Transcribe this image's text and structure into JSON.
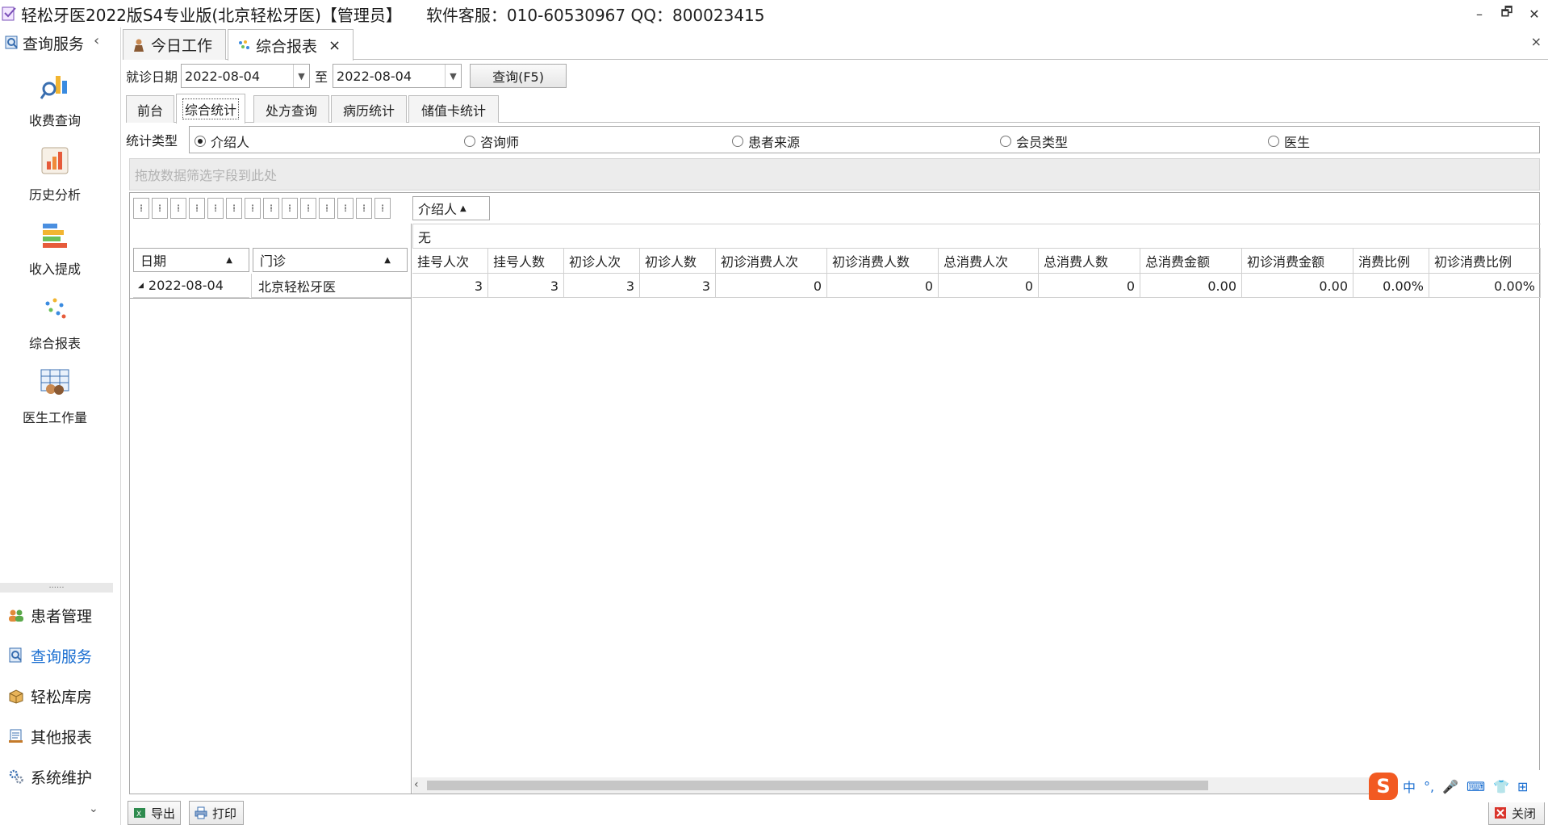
{
  "window": {
    "title": "轻松牙医2022版S4专业版(北京轻松牙医)【管理员】",
    "support": "软件客服：010-60530967 QQ：800023415",
    "controls": [
      "–",
      "🗗",
      "✕"
    ]
  },
  "sidebar": {
    "header": "查询服务",
    "collapse_glyph": "‹",
    "big_items": [
      {
        "label": "收费查询",
        "icon": "fee-query-icon"
      },
      {
        "label": "历史分析",
        "icon": "history-analysis-icon"
      },
      {
        "label": "收入提成",
        "icon": "income-commission-icon"
      },
      {
        "label": "综合报表",
        "icon": "comprehensive-report-icon"
      },
      {
        "label": "医生工作量",
        "icon": "doctor-workload-icon"
      }
    ],
    "grip": "......",
    "groups": [
      {
        "label": "患者管理",
        "icon": "patients-icon"
      },
      {
        "label": "查询服务",
        "icon": "query-service-icon",
        "active": true
      },
      {
        "label": "轻松库房",
        "icon": "warehouse-icon"
      },
      {
        "label": "其他报表",
        "icon": "other-reports-icon"
      },
      {
        "label": "系统维护",
        "icon": "system-maintenance-icon"
      }
    ],
    "more_glyph": "⌄"
  },
  "doc_tabs": [
    {
      "label": "今日工作",
      "icon": "today-work-icon"
    },
    {
      "label": "综合报表",
      "icon": "report-icon",
      "active": true,
      "close": "×"
    }
  ],
  "doc_close": "×",
  "filter": {
    "date_label": "就诊日期",
    "date_from": "2022-08-04",
    "to_label": "至",
    "date_to": "2022-08-04",
    "query_button": "查询(F5)"
  },
  "sub_tabs": [
    "前台",
    "综合统计",
    "处方查询",
    "病历统计",
    "储值卡统计"
  ],
  "active_sub_tab": "综合统计",
  "stat_type": {
    "label": "统计类型",
    "options": [
      "介绍人",
      "咨询师",
      "患者来源",
      "会员类型",
      "医生"
    ],
    "selected": "介绍人"
  },
  "drop_area_hint": "拖放数据筛选字段到此处",
  "pivot": {
    "column_field": "介绍人",
    "column_value": "无",
    "row_fields": [
      "日期",
      "门诊"
    ],
    "columns": [
      "挂号人次",
      "挂号人数",
      "初诊人次",
      "初诊人数",
      "初诊消费人次",
      "初诊消费人数",
      "总消费人次",
      "总消费人数",
      "总消费金额",
      "初诊消费金额",
      "消费比例",
      "初诊消费比例"
    ],
    "rows": [
      {
        "date": "2022-08-04",
        "clinic": "北京轻松牙医",
        "values": [
          "3",
          "3",
          "3",
          "3",
          "0",
          "0",
          "0",
          "0",
          "0.00",
          "0.00",
          "0.00%",
          "0.00%"
        ]
      }
    ]
  },
  "bottom": {
    "export": "导出",
    "print": "打印",
    "close": "关闭"
  },
  "ime": {
    "logo": "S",
    "mode": "中",
    "punct": "°,",
    "items": [
      "🎤",
      "⌨",
      "👕",
      "⊞"
    ]
  },
  "colors": {
    "active_nav": "#1b6fd1",
    "ime_logo": "#f25a22"
  }
}
